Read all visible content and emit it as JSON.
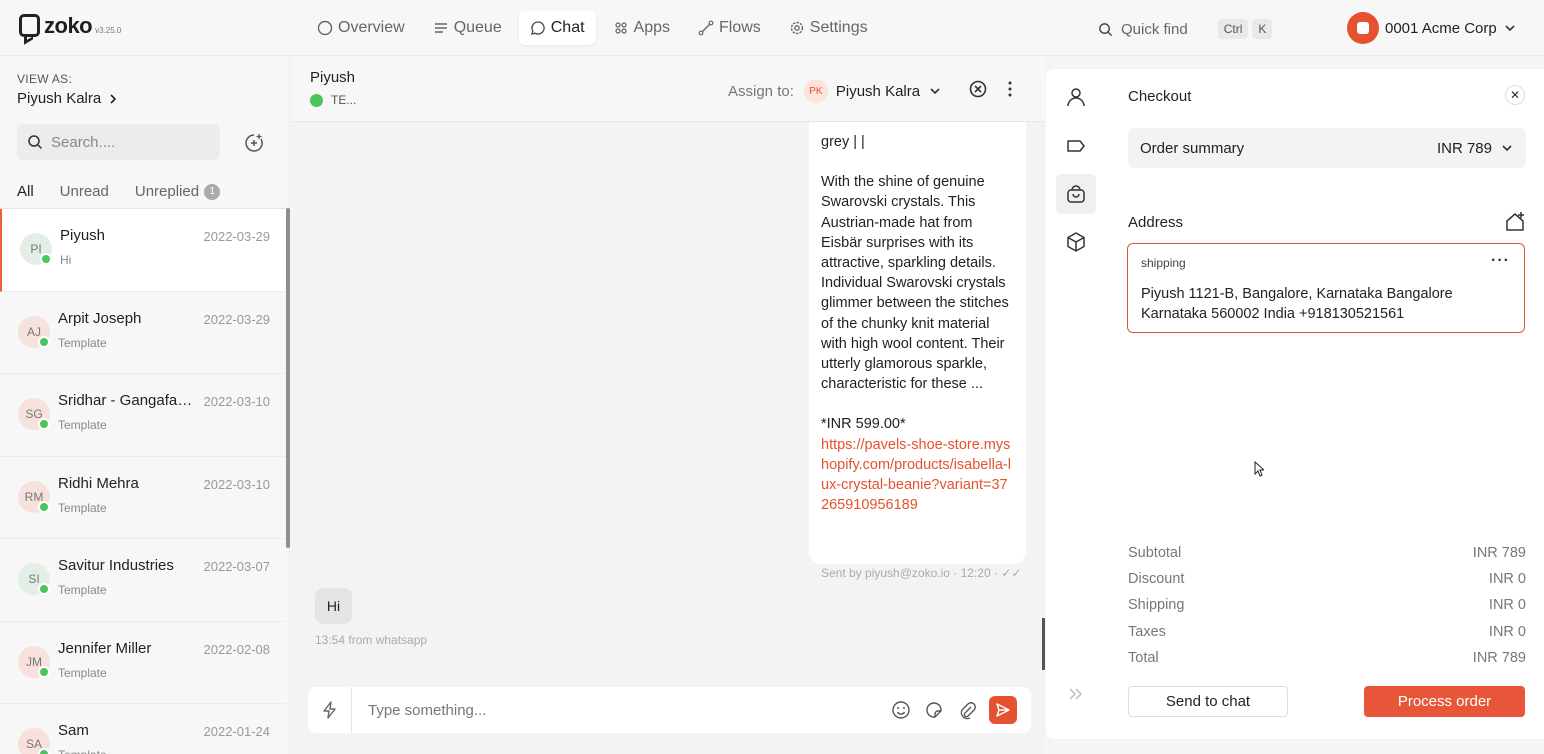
{
  "app": {
    "logo_text": "zoko",
    "version": "v3.25.0",
    "nav": [
      {
        "label": "Overview",
        "icon": "circle-icon"
      },
      {
        "label": "Queue",
        "icon": "list-icon"
      },
      {
        "label": "Chat",
        "icon": "chat-bubble-icon"
      },
      {
        "label": "Apps",
        "icon": "grid-icon"
      },
      {
        "label": "Flows",
        "icon": "flow-icon"
      },
      {
        "label": "Settings",
        "icon": "gear-icon"
      }
    ],
    "active_nav": "Chat",
    "quickfind": {
      "label": "Quick find",
      "key1": "Ctrl",
      "key2": "K"
    },
    "account": "0001 Acme Corp",
    "accent_color": "#e5522f"
  },
  "sidebar": {
    "view_as_label": "VIEW AS:",
    "view_as_name": "Piyush Kalra",
    "search_placeholder": "Search....",
    "tabs": [
      {
        "label": "All"
      },
      {
        "label": "Unread"
      },
      {
        "label": "Unreplied",
        "count": "1"
      }
    ],
    "conversations": [
      {
        "initials": "PI",
        "name": "Piyush",
        "date": "2022-03-29",
        "preview": "Hi",
        "avatar_bg": "#e3efe6"
      },
      {
        "initials": "AJ",
        "name": "Arpit Joseph",
        "date": "2022-03-29",
        "preview": "Template",
        "avatar_bg": "#f7e1dc"
      },
      {
        "initials": "SG",
        "name": "Sridhar - Gangafashions",
        "date": "2022-03-10",
        "preview": "Template",
        "avatar_bg": "#f7e1dc"
      },
      {
        "initials": "RM",
        "name": "Ridhi Mehra",
        "date": "2022-03-10",
        "preview": "Template",
        "avatar_bg": "#f7e1dc"
      },
      {
        "initials": "SI",
        "name": "Savitur Industries",
        "date": "2022-03-07",
        "preview": "Template",
        "avatar_bg": "#e3efe6"
      },
      {
        "initials": "JM",
        "name": "Jennifer Miller",
        "date": "2022-02-08",
        "preview": "Template",
        "avatar_bg": "#f7e1dc"
      },
      {
        "initials": "SA",
        "name": "Sam",
        "date": "2022-01-24",
        "preview": "Template",
        "avatar_bg": "#f7e1dc"
      }
    ]
  },
  "chat": {
    "contact_name": "Piyush",
    "contact_sub": "TE...",
    "assign_label": "Assign to:",
    "assignee_initials": "PK",
    "assignee_name": "Piyush Kalra",
    "outgoing": {
      "line1": "grey |  |",
      "body": "With the shine of genuine Swarovski crystals. This Austrian-made hat from Eisbär surprises with its attractive, sparkling details. Individual Swarovski crystals glimmer between the stitches of the chunky knit material with high wool content. Their utterly glamorous sparkle, characteristic for these  ...",
      "price": "*INR 599.00*",
      "link": "https://pavels-shoe-store.myshopify.com/products/isabella-lux-crystal-beanie?variant=37265910956189",
      "meta": "Sent by piyush@zoko.io · 12:20 · ✓✓"
    },
    "incoming": {
      "text": "Hi",
      "meta": "13:54 from whatsapp"
    },
    "composer_placeholder": "Type something..."
  },
  "checkout": {
    "title": "Checkout",
    "summary_label": "Order summary",
    "summary_value": "INR 789",
    "address_title": "Address",
    "address_type": "shipping",
    "address_text": "Piyush 1121-B, Bangalore, Karnataka Bangalore Karnataka 560002 India +918130521561",
    "totals": [
      {
        "label": "Subtotal",
        "value": "INR 789"
      },
      {
        "label": "Discount",
        "value": "INR 0"
      },
      {
        "label": "Shipping",
        "value": "INR 0"
      },
      {
        "label": "Taxes",
        "value": "INR 0"
      },
      {
        "label": "Total",
        "value": "INR 789"
      }
    ],
    "send_label": "Send to chat",
    "process_label": "Process order"
  }
}
